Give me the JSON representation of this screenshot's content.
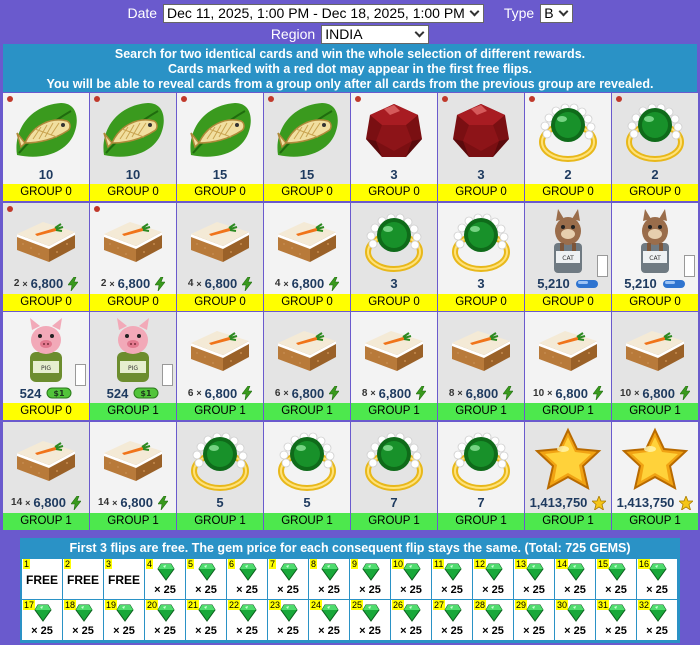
{
  "controls": {
    "date_label": "Date",
    "date_value": "Dec 11, 2025, 1:00 PM - Dec 18, 2025, 1:00 PM",
    "type_label": "Type",
    "type_value": "B",
    "region_label": "Region",
    "region_value": "INDIA"
  },
  "banner": {
    "line1": "Search for two identical cards and win the whole selection of different rewards.",
    "line2": "Cards marked with a red dot may appear in the first free flips.",
    "line3": "You will be able to reveal cards from a group only after all cards from the previous group are revealed."
  },
  "colors": {
    "background": "#6a5acd",
    "panel": "#2a92c6",
    "group0": "#ffff00",
    "group1": "#4de84d"
  },
  "cards": [
    {
      "item": "fish-leaf",
      "value": "10",
      "group": "GROUP 0",
      "dot": true
    },
    {
      "item": "fish-leaf",
      "value": "10",
      "group": "GROUP 0",
      "dot": true
    },
    {
      "item": "fish-leaf",
      "value": "15",
      "group": "GROUP 0",
      "dot": true
    },
    {
      "item": "fish-leaf",
      "value": "15",
      "group": "GROUP 0",
      "dot": true
    },
    {
      "item": "red-gem",
      "value": "3",
      "group": "GROUP 0",
      "dot": true
    },
    {
      "item": "red-gem",
      "value": "3",
      "group": "GROUP 0",
      "dot": true
    },
    {
      "item": "green-ring",
      "value": "2",
      "group": "GROUP 0",
      "dot": true
    },
    {
      "item": "green-ring",
      "value": "2",
      "group": "GROUP 0",
      "dot": true
    },
    {
      "item": "carrot-cake",
      "mult": "2",
      "value": "6,800",
      "icon": "energy",
      "group": "GROUP 0",
      "dot": true
    },
    {
      "item": "carrot-cake",
      "mult": "2",
      "value": "6,800",
      "icon": "energy",
      "group": "GROUP 0",
      "dot": true
    },
    {
      "item": "carrot-cake",
      "mult": "4",
      "value": "6,800",
      "icon": "energy",
      "group": "GROUP 0",
      "dot": false
    },
    {
      "item": "carrot-cake",
      "mult": "4",
      "value": "6,800",
      "icon": "energy",
      "group": "GROUP 0",
      "dot": false
    },
    {
      "item": "green-ring",
      "value": "3",
      "group": "GROUP 0",
      "dot": false
    },
    {
      "item": "green-ring",
      "value": "3",
      "group": "GROUP 0",
      "dot": false
    },
    {
      "item": "cat-jar",
      "value": "5,210",
      "icon": "pill",
      "group": "GROUP 0",
      "dot": false,
      "checkbox": true
    },
    {
      "item": "cat-jar",
      "value": "5,210",
      "icon": "pill",
      "group": "GROUP 0",
      "dot": false,
      "checkbox": true
    },
    {
      "item": "pig-jar",
      "value": "524",
      "icon": "ticket",
      "group": "GROUP 0",
      "dot": false,
      "checkbox": true
    },
    {
      "item": "pig-jar",
      "value": "524",
      "icon": "ticket",
      "group": "GROUP 1",
      "dot": false,
      "checkbox": true
    },
    {
      "item": "carrot-cake",
      "mult": "6",
      "value": "6,800",
      "icon": "energy",
      "group": "GROUP 1",
      "dot": false
    },
    {
      "item": "carrot-cake",
      "mult": "6",
      "value": "6,800",
      "icon": "energy",
      "group": "GROUP 1",
      "dot": false
    },
    {
      "item": "carrot-cake",
      "mult": "8",
      "value": "6,800",
      "icon": "energy",
      "group": "GROUP 1",
      "dot": false
    },
    {
      "item": "carrot-cake",
      "mult": "8",
      "value": "6,800",
      "icon": "energy",
      "group": "GROUP 1",
      "dot": false
    },
    {
      "item": "carrot-cake",
      "mult": "10",
      "value": "6,800",
      "icon": "energy",
      "group": "GROUP 1",
      "dot": false
    },
    {
      "item": "carrot-cake",
      "mult": "10",
      "value": "6,800",
      "icon": "energy",
      "group": "GROUP 1",
      "dot": false
    },
    {
      "item": "carrot-cake",
      "mult": "14",
      "value": "6,800",
      "icon": "energy",
      "group": "GROUP 1",
      "dot": false
    },
    {
      "item": "carrot-cake",
      "mult": "14",
      "value": "6,800",
      "icon": "energy",
      "group": "GROUP 1",
      "dot": false
    },
    {
      "item": "green-ring",
      "value": "5",
      "group": "GROUP 1",
      "dot": false
    },
    {
      "item": "green-ring",
      "value": "5",
      "group": "GROUP 1",
      "dot": false
    },
    {
      "item": "green-ring",
      "value": "7",
      "group": "GROUP 1",
      "dot": false
    },
    {
      "item": "green-ring",
      "value": "7",
      "group": "GROUP 1",
      "dot": false
    },
    {
      "item": "gold-star",
      "value": "1,413,750",
      "icon": "star",
      "group": "GROUP 1",
      "dot": false
    },
    {
      "item": "gold-star",
      "value": "1,413,750",
      "icon": "star",
      "group": "GROUP 1",
      "dot": false
    }
  ],
  "flips": {
    "title": "First 3 flips are free. The gem price for each consequent flip stays the same. (Total: 725 GEMS)",
    "items": [
      {
        "num": "1",
        "free": "FREE"
      },
      {
        "num": "2",
        "free": "FREE"
      },
      {
        "num": "3",
        "free": "FREE"
      },
      {
        "num": "4",
        "cost": "× 25"
      },
      {
        "num": "5",
        "cost": "× 25"
      },
      {
        "num": "6",
        "cost": "× 25"
      },
      {
        "num": "7",
        "cost": "× 25"
      },
      {
        "num": "8",
        "cost": "× 25"
      },
      {
        "num": "9",
        "cost": "× 25"
      },
      {
        "num": "10",
        "cost": "× 25"
      },
      {
        "num": "11",
        "cost": "× 25"
      },
      {
        "num": "12",
        "cost": "× 25"
      },
      {
        "num": "13",
        "cost": "× 25"
      },
      {
        "num": "14",
        "cost": "× 25"
      },
      {
        "num": "15",
        "cost": "× 25"
      },
      {
        "num": "16",
        "cost": "× 25"
      },
      {
        "num": "17",
        "cost": "× 25"
      },
      {
        "num": "18",
        "cost": "× 25"
      },
      {
        "num": "19",
        "cost": "× 25"
      },
      {
        "num": "20",
        "cost": "× 25"
      },
      {
        "num": "21",
        "cost": "× 25"
      },
      {
        "num": "22",
        "cost": "× 25"
      },
      {
        "num": "23",
        "cost": "× 25"
      },
      {
        "num": "24",
        "cost": "× 25"
      },
      {
        "num": "25",
        "cost": "× 25"
      },
      {
        "num": "26",
        "cost": "× 25"
      },
      {
        "num": "27",
        "cost": "× 25"
      },
      {
        "num": "28",
        "cost": "× 25"
      },
      {
        "num": "29",
        "cost": "× 25"
      },
      {
        "num": "30",
        "cost": "× 25"
      },
      {
        "num": "31",
        "cost": "× 25"
      },
      {
        "num": "32",
        "cost": "× 25"
      }
    ]
  }
}
